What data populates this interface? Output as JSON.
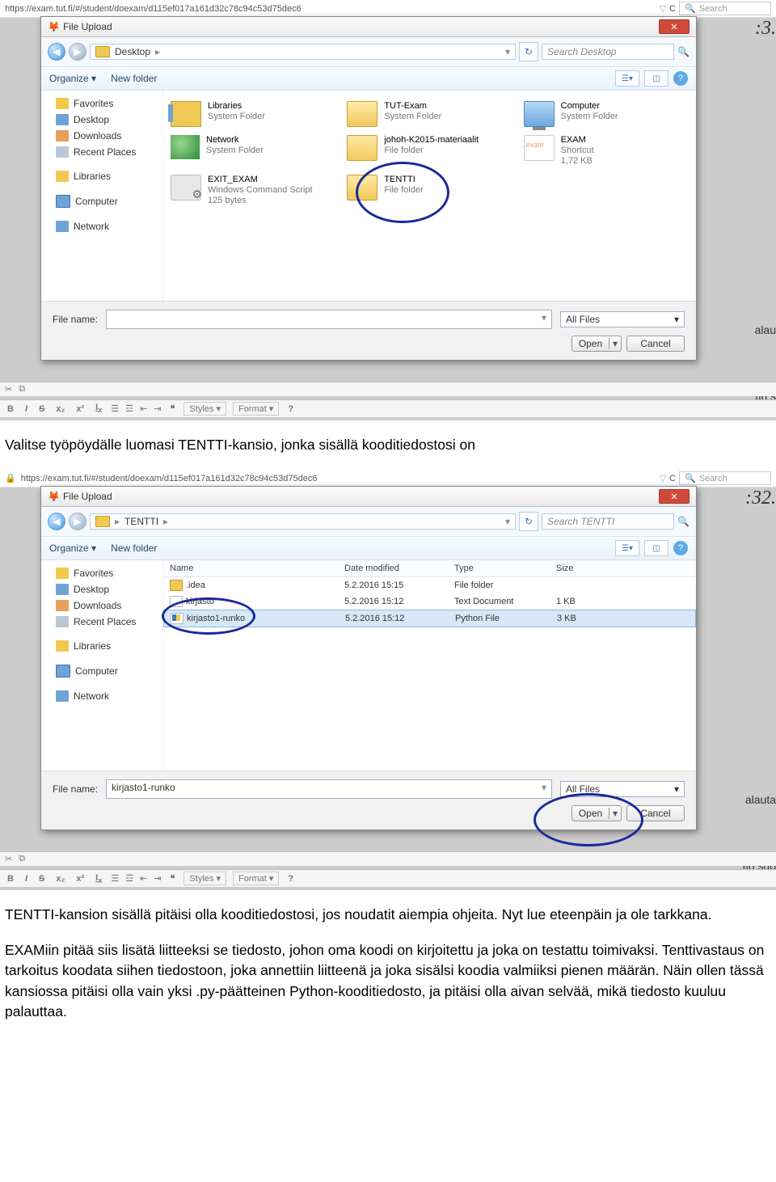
{
  "shot1": {
    "url": "https://exam.tut.fi/#/student/doexam/d115ef017a161d32c78c94c53d75dec6",
    "searchPlaceholder": "Search",
    "timer": ":3.",
    "bgText1": "alau",
    "bgText2": "tin s",
    "dialog": {
      "title": "File Upload",
      "crumb": "Desktop",
      "searchHint": "Search Desktop",
      "organize": "Organize ▾",
      "newFolder": "New folder",
      "sidebar": {
        "favorites": "Favorites",
        "desktop": "Desktop",
        "downloads": "Downloads",
        "recent": "Recent Places",
        "libraries": "Libraries",
        "computer": "Computer",
        "network": "Network"
      },
      "items": {
        "libraries": {
          "name": "Libraries",
          "sub": "System Folder"
        },
        "network": {
          "name": "Network",
          "sub": "System Folder"
        },
        "exit": {
          "name": "EXIT_EXAM",
          "sub": "Windows Command Script",
          "sub2": "125 bytes"
        },
        "tut": {
          "name": "TUT-Exam",
          "sub": "System Folder"
        },
        "johoh": {
          "name": "johoh-K2015-materiaalit",
          "sub": "File folder"
        },
        "tentti": {
          "name": "TENTTI",
          "sub": "File folder"
        },
        "computer": {
          "name": "Computer",
          "sub": "System Folder"
        },
        "exam": {
          "name": "EXAM",
          "sub": "Shortcut",
          "sub2": "1,72 KB"
        }
      },
      "fnLabel": "File name:",
      "fnValue": "",
      "filter": "All Files",
      "open": "Open",
      "cancel": "Cancel"
    },
    "editor": {
      "styles": "Styles",
      "format": "Format"
    }
  },
  "instr1": "Valitse työpöydälle luomasi TENTTI-kansio, jonka sisällä kooditiedostosi on",
  "shot2": {
    "url": "https://exam.tut.fi/#/student/doexam/d115ef017a161d32c78c94c53d75dec6",
    "timer": ":32.",
    "bgText1": "alauta",
    "bgText2": "tin suo",
    "dialog": {
      "title": "File Upload",
      "crumb": "TENTTI",
      "searchHint": "Search TENTTI",
      "organize": "Organize ▾",
      "newFolder": "New folder",
      "cols": {
        "name": "Name",
        "date": "Date modified",
        "type": "Type",
        "size": "Size"
      },
      "rows": [
        {
          "name": ".idea",
          "date": "5.2.2016 15:15",
          "type": "File folder",
          "size": ""
        },
        {
          "name": "kirjasto",
          "date": "5.2.2016 15:12",
          "type": "Text Document",
          "size": "1 KB"
        },
        {
          "name": "kirjasto1-runko",
          "date": "5.2.2016 15:12",
          "type": "Python File",
          "size": "3 KB"
        }
      ],
      "fnLabel": "File name:",
      "fnValue": "kirjasto1-runko",
      "filter": "All Files",
      "open": "Open",
      "cancel": "Cancel"
    }
  },
  "para1": "TENTTI-kansion sisällä pitäisi olla kooditiedostosi, jos noudatit aiempia ohjeita. Nyt lue eteenpäin ja ole tarkkana.",
  "para2": "EXAMiin pitää siis lisätä liitteeksi se tiedosto, johon oma koodi on kirjoitettu ja joka on testattu toimivaksi. Tenttivastaus on tarkoitus koodata siihen tiedostoon, joka annettiin liitteenä ja joka sisälsi koodia valmiiksi pienen määrän. Näin ollen tässä kansiossa pitäisi olla vain yksi .py-päätteinen Python-kooditiedosto, ja pitäisi olla aivan selvää, mikä tiedosto kuuluu palauttaa."
}
